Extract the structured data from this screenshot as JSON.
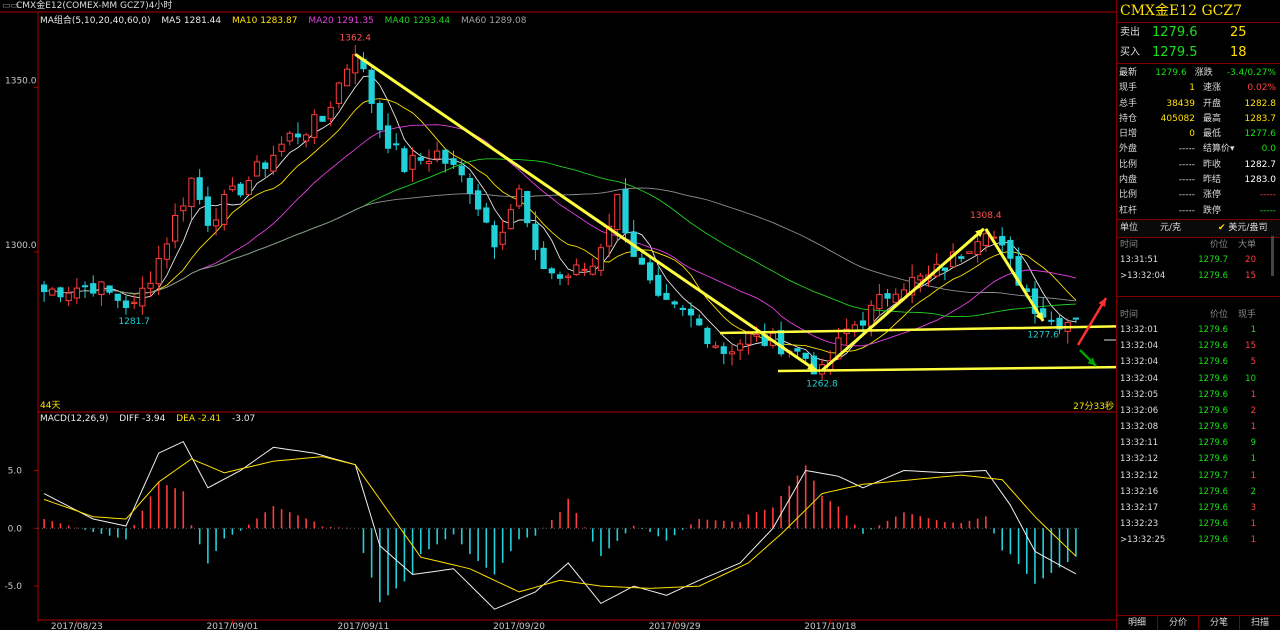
{
  "window": {
    "title": "CMX金E12(COMEX-MM GCZ7)4小时",
    "controls": "▭▭"
  },
  "main_chart": {
    "ma_legend": [
      {
        "text": "MA组合(5,10,20,40,60,0)",
        "color": "#e8e8e8"
      },
      {
        "text": "MA5 1281.44",
        "color": "#e8e8e8"
      },
      {
        "text": "MA10 1283.87",
        "color": "#ffe000"
      },
      {
        "text": "MA20 1291.35",
        "color": "#e040e0"
      },
      {
        "text": "MA40 1293.44",
        "color": "#20d020"
      },
      {
        "text": "MA60 1289.08",
        "color": "#a0a0a0"
      }
    ],
    "y_ticks": [
      {
        "label": "1350.0",
        "value": 1350.0
      },
      {
        "label": "1300.0",
        "value": 1300.0
      }
    ],
    "annotations": {
      "high": {
        "label": "1362.4",
        "value": 1362.4,
        "bar": 38
      },
      "low_start": {
        "label": "1281.7",
        "value": 1281.7,
        "bar": 11
      },
      "low_mid": {
        "label": "1262.8",
        "value": 1262.8,
        "bar": 95
      },
      "high2": {
        "label": "1308.4",
        "value": 1308.4,
        "bar": 115
      },
      "low_last": {
        "label": "1277.6",
        "value": 1277.6,
        "bar": 122
      }
    },
    "days_label": "44天",
    "countdown": "27分33秒"
  },
  "macd": {
    "legend": [
      {
        "text": "MACD(12,26,9)",
        "color": "#e8e8e8"
      },
      {
        "text": "DIFF -3.94",
        "color": "#e8e8e8"
      },
      {
        "text": "DEA -2.41",
        "color": "#ffe000"
      },
      {
        "text": "-3.07",
        "color": "#e8e8e8"
      }
    ],
    "y_ticks": [
      {
        "label": "5.0",
        "value": 5.0
      },
      {
        "label": "0.0",
        "value": 0.0
      },
      {
        "label": "-5.0",
        "value": -5.0
      }
    ]
  },
  "x_axis": {
    "dates": [
      {
        "label": "2017/08/23",
        "bar": 4
      },
      {
        "label": "2017/09/01",
        "bar": 23
      },
      {
        "label": "2017/09/11",
        "bar": 39
      },
      {
        "label": "2017/09/20",
        "bar": 58
      },
      {
        "label": "2017/09/29",
        "bar": 77
      },
      {
        "label": "2017/10/18",
        "bar": 96
      }
    ]
  },
  "chart_data": {
    "type": "candlestick",
    "title": "CMX金E12(COMEX-MM GCZ7)4小时",
    "ylim": [
      1255,
      1368
    ],
    "macd_ylim": [
      -7.5,
      8.5
    ],
    "bars": 127,
    "key_closes": [
      [
        0,
        1288
      ],
      [
        6,
        1290
      ],
      [
        11,
        1283
      ],
      [
        14,
        1298
      ],
      [
        18,
        1322
      ],
      [
        20,
        1310
      ],
      [
        25,
        1322
      ],
      [
        30,
        1335
      ],
      [
        34,
        1340
      ],
      [
        38,
        1362
      ],
      [
        41,
        1338
      ],
      [
        44,
        1326
      ],
      [
        48,
        1330
      ],
      [
        52,
        1320
      ],
      [
        55,
        1304
      ],
      [
        58,
        1318
      ],
      [
        60,
        1298
      ],
      [
        63,
        1292
      ],
      [
        67,
        1296
      ],
      [
        70,
        1316
      ],
      [
        72,
        1300
      ],
      [
        75,
        1284
      ],
      [
        79,
        1280
      ],
      [
        83,
        1270
      ],
      [
        86,
        1274
      ],
      [
        90,
        1272
      ],
      [
        93,
        1268
      ],
      [
        95,
        1262.8
      ],
      [
        98,
        1276
      ],
      [
        101,
        1282
      ],
      [
        104,
        1290
      ],
      [
        108,
        1292
      ],
      [
        112,
        1300
      ],
      [
        115,
        1308.4
      ],
      [
        118,
        1296
      ],
      [
        121,
        1284
      ],
      [
        123,
        1279
      ],
      [
        126,
        1279.6
      ]
    ],
    "macd_series": {
      "diff_key": [
        [
          0,
          3.0
        ],
        [
          6,
          0.8
        ],
        [
          10,
          0.2
        ],
        [
          14,
          6.5
        ],
        [
          17,
          7.5
        ],
        [
          20,
          3.5
        ],
        [
          24,
          5.0
        ],
        [
          28,
          7.0
        ],
        [
          33,
          6.5
        ],
        [
          38,
          5.5
        ],
        [
          41,
          -1.5
        ],
        [
          45,
          -4.0
        ],
        [
          50,
          -3.5
        ],
        [
          55,
          -7.0
        ],
        [
          60,
          -5.5
        ],
        [
          64,
          -3.0
        ],
        [
          68,
          -6.5
        ],
        [
          72,
          -5.0
        ],
        [
          76,
          -5.8
        ],
        [
          80,
          -4.5
        ],
        [
          85,
          -3.0
        ],
        [
          89,
          0.0
        ],
        [
          93,
          5.0
        ],
        [
          97,
          4.5
        ],
        [
          100,
          3.5
        ],
        [
          105,
          5.0
        ],
        [
          110,
          4.8
        ],
        [
          115,
          5.0
        ],
        [
          118,
          2.0
        ],
        [
          121,
          -2.0
        ],
        [
          126,
          -3.94
        ]
      ],
      "dea_key": [
        [
          0,
          2.5
        ],
        [
          6,
          1.0
        ],
        [
          10,
          0.8
        ],
        [
          14,
          4.0
        ],
        [
          18,
          6.0
        ],
        [
          22,
          4.8
        ],
        [
          28,
          5.8
        ],
        [
          34,
          6.2
        ],
        [
          38,
          5.5
        ],
        [
          42,
          1.5
        ],
        [
          46,
          -2.5
        ],
        [
          52,
          -3.5
        ],
        [
          58,
          -5.5
        ],
        [
          63,
          -4.5
        ],
        [
          68,
          -5.0
        ],
        [
          74,
          -5.2
        ],
        [
          80,
          -5.0
        ],
        [
          86,
          -3.0
        ],
        [
          90,
          -0.5
        ],
        [
          95,
          3.0
        ],
        [
          100,
          3.8
        ],
        [
          106,
          4.2
        ],
        [
          112,
          4.6
        ],
        [
          117,
          4.2
        ],
        [
          121,
          1.0
        ],
        [
          126,
          -2.41
        ]
      ]
    }
  },
  "right_panel": {
    "symbol": "CMX金E12  GCZ7",
    "ask": {
      "label": "卖出",
      "price": "1279.6",
      "volume": "25"
    },
    "bid": {
      "label": "买入",
      "price": "1279.5",
      "volume": "18"
    },
    "stats": [
      {
        "l1": "最新",
        "v1": "1279.6",
        "c1": "#18e018",
        "l2": "涨跌",
        "v2": "-3.4/0.27%",
        "c2": "#18e018"
      },
      {
        "l1": "现手",
        "v1": "1",
        "c1": "#ffe000",
        "l2": "速涨",
        "v2": "0.02%",
        "c2": "#ff4040"
      },
      {
        "l1": "总手",
        "v1": "38439",
        "c1": "#ffe000",
        "l2": "开盘",
        "v2": "1282.8",
        "c2": "#ffe000"
      },
      {
        "l1": "持仓",
        "v1": "405082",
        "c1": "#ffe000",
        "l2": "最高",
        "v2": "1283.7",
        "c2": "#ffe000"
      },
      {
        "l1": "日增",
        "v1": "0",
        "c1": "#ffe000",
        "l2": "最低",
        "v2": "1277.6",
        "c2": "#18e018"
      },
      {
        "l1": "外盘",
        "v1": "-----",
        "c1": "#ddd",
        "l2": "结算价▾",
        "v2": "0.0",
        "c2": "#18e018"
      },
      {
        "l1": "比例",
        "v1": "-----",
        "c1": "#ddd",
        "l2": "昨收",
        "v2": "1282.7",
        "c2": "#ffffff"
      },
      {
        "l1": "内盘",
        "v1": "-----",
        "c1": "#ddd",
        "l2": "昨结",
        "v2": "1283.0",
        "c2": "#ffffff"
      },
      {
        "l1": "比例",
        "v1": "-----",
        "c1": "#ddd",
        "l2": "涨停",
        "v2": "-----",
        "c2": "#ff4040"
      },
      {
        "l1": "杠杆",
        "v1": "-----",
        "c1": "#ddd",
        "l2": "跌停",
        "v2": "-----",
        "c2": "#18e018"
      }
    ],
    "unit": {
      "label": "单位",
      "value": "元/克",
      "check": "✔",
      "alt": "美元/盎司"
    },
    "big_trades_header": {
      "time": "时间",
      "price": "价位",
      "vol": "大单"
    },
    "big_trades": [
      {
        "time": "13:31:51",
        "price": "1279.7",
        "vol": "20",
        "color": "#ff4040"
      },
      {
        "time": ">13:32:04",
        "price": "1279.6",
        "vol": "15",
        "color": "#ff4040"
      }
    ],
    "ticks_header": {
      "time": "时间",
      "price": "价位",
      "vol": "现手"
    },
    "ticks": [
      {
        "time": "13:32:01",
        "price": "1279.6",
        "vol": "1",
        "color": "#18e018"
      },
      {
        "time": "13:32:04",
        "price": "1279.6",
        "vol": "15",
        "color": "#ff4040"
      },
      {
        "time": "13:32:04",
        "price": "1279.6",
        "vol": "5",
        "color": "#ff4040"
      },
      {
        "time": "13:32:04",
        "price": "1279.6",
        "vol": "10",
        "color": "#18e018"
      },
      {
        "time": "13:32:05",
        "price": "1279.6",
        "vol": "1",
        "color": "#ff4040"
      },
      {
        "time": "13:32:06",
        "price": "1279.6",
        "vol": "2",
        "color": "#ff4040"
      },
      {
        "time": "13:32:08",
        "price": "1279.6",
        "vol": "1",
        "color": "#ff4040"
      },
      {
        "time": "13:32:11",
        "price": "1279.6",
        "vol": "9",
        "color": "#18e018"
      },
      {
        "time": "13:32:12",
        "price": "1279.6",
        "vol": "1",
        "color": "#18e018"
      },
      {
        "time": "13:32:12",
        "price": "1279.7",
        "vol": "1",
        "color": "#ff4040"
      },
      {
        "time": "13:32:16",
        "price": "1279.6",
        "vol": "2",
        "color": "#18e018"
      },
      {
        "time": "13:32:17",
        "price": "1279.6",
        "vol": "3",
        "color": "#ff4040"
      },
      {
        "time": "13:32:23",
        "price": "1279.6",
        "vol": "1",
        "color": "#ff4040"
      },
      {
        "time": ">13:32:25",
        "price": "1279.6",
        "vol": "1",
        "color": "#ff4040"
      }
    ],
    "tabs": [
      "明细",
      "分价",
      "分笔",
      "扫描"
    ]
  },
  "colors": {
    "up": "#ff3c3c",
    "down": "#22d0d8",
    "trend": "#ffff40",
    "grid": "#800000",
    "axis": "#b00000"
  }
}
